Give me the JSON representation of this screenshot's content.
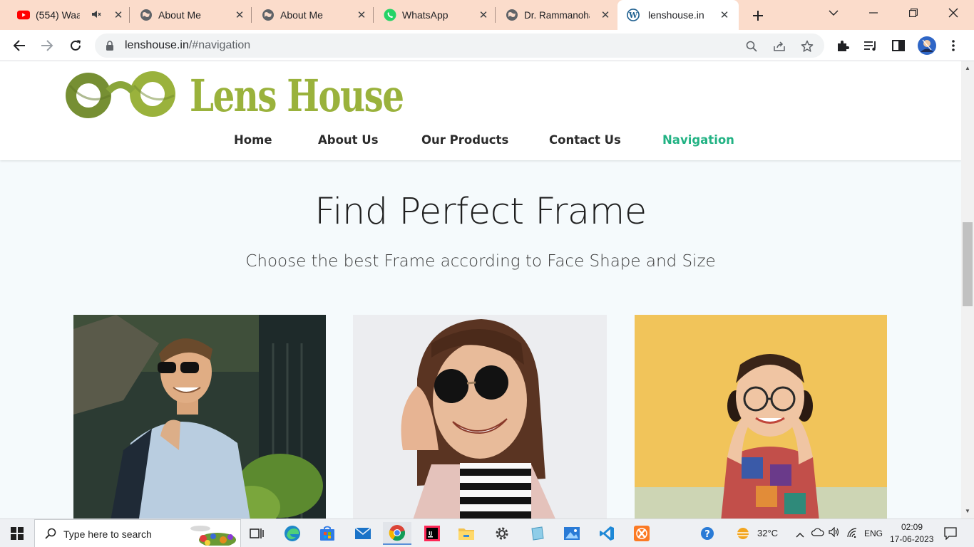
{
  "browser": {
    "tabs": [
      {
        "title": "(554) Waal",
        "icon": "youtube-icon",
        "muted": true
      },
      {
        "title": "About Me",
        "icon": "globe-icon"
      },
      {
        "title": "About Me",
        "icon": "globe-icon"
      },
      {
        "title": "WhatsApp",
        "icon": "whatsapp-icon"
      },
      {
        "title": "Dr. Rammanoha",
        "icon": "globe-icon"
      },
      {
        "title": "lenshouse.in",
        "icon": "wordpress-icon",
        "active": true
      }
    ],
    "address": {
      "host": "lenshouse.in",
      "path": "/#navigation"
    }
  },
  "site": {
    "logo_text": "Lens House",
    "nav": [
      "Home",
      "About Us",
      "Our Products",
      "Contact Us",
      "Navigation"
    ],
    "active_nav": "Navigation",
    "hero_title": "Find Perfect Frame",
    "hero_subtitle": "Choose the best Frame according to Face Shape and Size"
  },
  "taskbar": {
    "search_placeholder": "Type here to search",
    "weather": "32°C",
    "language": "ENG",
    "time": "02:09",
    "date": "17-06-2023"
  },
  "colors": {
    "tab_strip": "#fbdccb",
    "brand_green": "#9ab23c",
    "nav_active": "#21b283",
    "page_bg": "#f5fafc"
  }
}
